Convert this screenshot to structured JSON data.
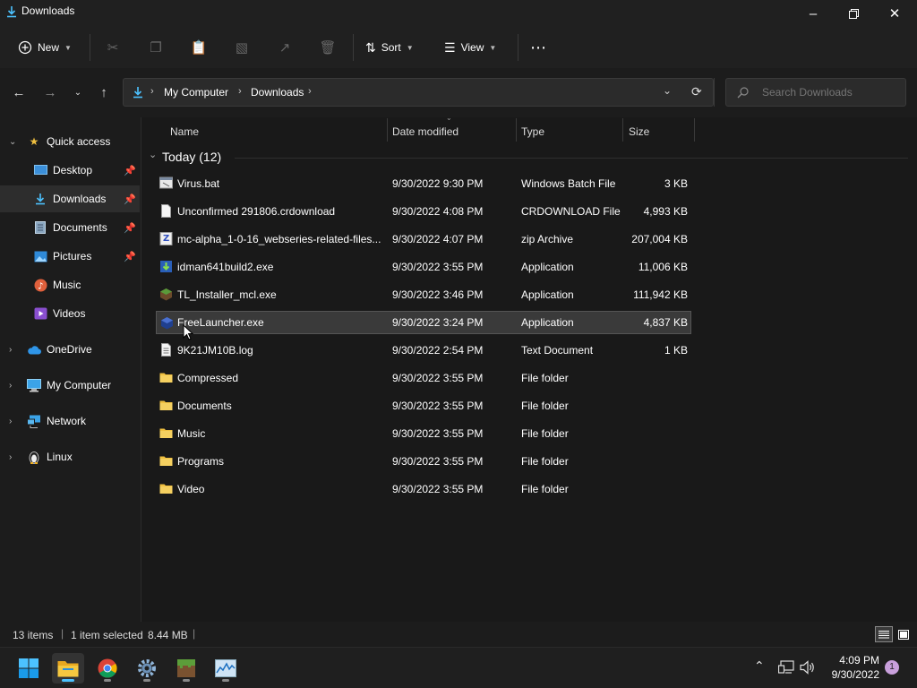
{
  "window": {
    "title": "Downloads",
    "icons": {
      "app": "download-icon",
      "minimize": "minimize-icon",
      "maximize": "restore-icon",
      "close": "close-icon"
    }
  },
  "commands": {
    "new_label": "New",
    "sort_label": "Sort",
    "view_label": "View",
    "more": "more-icon"
  },
  "breadcrumb": [
    "My Computer",
    "Downloads"
  ],
  "search": {
    "placeholder": "Search Downloads"
  },
  "sidebar": {
    "items": [
      {
        "label": "Quick access",
        "icon": "star-icon"
      },
      {
        "label": "Desktop",
        "icon": "desktop-icon"
      },
      {
        "label": "Downloads",
        "icon": "download-icon"
      },
      {
        "label": "Documents",
        "icon": "documents-icon"
      },
      {
        "label": "Pictures",
        "icon": "pictures-icon"
      },
      {
        "label": "Music",
        "icon": "music-icon"
      },
      {
        "label": "Videos",
        "icon": "videos-icon"
      },
      {
        "label": "OneDrive",
        "icon": "cloud-icon"
      },
      {
        "label": "My Computer",
        "icon": "computer-icon"
      },
      {
        "label": "Network",
        "icon": "network-icon"
      },
      {
        "label": "Linux",
        "icon": "linux-icon"
      }
    ]
  },
  "columns": {
    "name": "Name",
    "date": "Date modified",
    "type": "Type",
    "size": "Size"
  },
  "group": {
    "label": "Today (12)"
  },
  "files": [
    {
      "name": "Virus.bat",
      "date": "9/30/2022 9:30 PM",
      "type": "Windows Batch File",
      "size": "3 KB",
      "icon": "batch-file-icon"
    },
    {
      "name": "Unconfirmed 291806.crdownload",
      "date": "9/30/2022 4:08 PM",
      "type": "CRDOWNLOAD File",
      "size": "4,993 KB",
      "icon": "file-icon"
    },
    {
      "name": "mc-alpha_1-0-16_webseries-related-files...",
      "date": "9/30/2022 4:07 PM",
      "type": "zip Archive",
      "size": "207,004 KB",
      "icon": "zip-icon"
    },
    {
      "name": "idman641build2.exe",
      "date": "9/30/2022 3:55 PM",
      "type": "Application",
      "size": "11,006 KB",
      "icon": "app-icon"
    },
    {
      "name": "TL_Installer_mcl.exe",
      "date": "9/30/2022 3:46 PM",
      "type": "Application",
      "size": "111,942 KB",
      "icon": "app-icon"
    },
    {
      "name": "FreeLauncher.exe",
      "date": "9/30/2022 3:24 PM",
      "type": "Application",
      "size": "4,837 KB",
      "icon": "app-icon"
    },
    {
      "name": "9K21JM10B.log",
      "date": "9/30/2022 2:54 PM",
      "type": "Text Document",
      "size": "1 KB",
      "icon": "text-file-icon"
    },
    {
      "name": "Compressed",
      "date": "9/30/2022 3:55 PM",
      "type": "File folder",
      "size": "",
      "icon": "folder-icon"
    },
    {
      "name": "Documents",
      "date": "9/30/2022 3:55 PM",
      "type": "File folder",
      "size": "",
      "icon": "folder-icon"
    },
    {
      "name": "Music",
      "date": "9/30/2022 3:55 PM",
      "type": "File folder",
      "size": "",
      "icon": "folder-icon"
    },
    {
      "name": "Programs",
      "date": "9/30/2022 3:55 PM",
      "type": "File folder",
      "size": "",
      "icon": "folder-icon"
    },
    {
      "name": "Video",
      "date": "9/30/2022 3:55 PM",
      "type": "File folder",
      "size": "",
      "icon": "folder-icon"
    }
  ],
  "status": {
    "items": "13 items",
    "selected": "1 item selected",
    "size": "8.44 MB"
  },
  "taskbar": {
    "time": "4:09 PM",
    "date": "9/30/2022",
    "notifications": "1"
  },
  "colors": {
    "accent": "#4cc2ff",
    "folder": "#f0c040",
    "selected_row": "#3a3a3a"
  }
}
